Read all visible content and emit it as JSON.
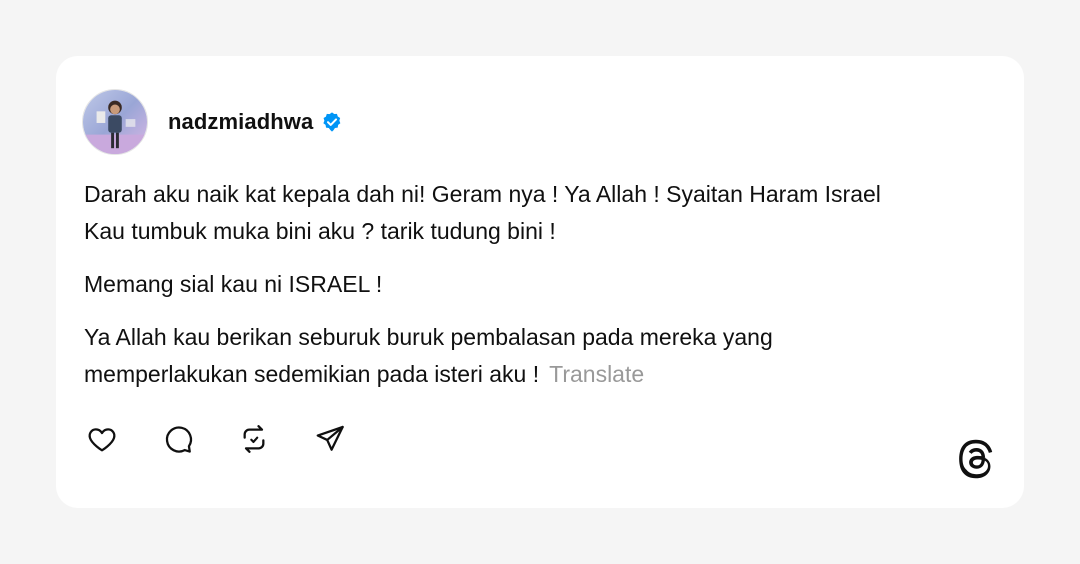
{
  "post": {
    "username": "nadzmiadhwa",
    "verified_badge_icon": "verified-check-icon",
    "avatar_icon": "user-avatar",
    "paragraphs": [
      {
        "line1": "Darah aku naik kat kepala dah ni! Geram nya ! Ya Allah ! Syaitan Haram Israel",
        "line2": "Kau tumbuk muka bini aku ? tarik tudung bini !"
      },
      {
        "line1": "Memang sial kau ni ISRAEL !"
      },
      {
        "line1": "Ya Allah kau berikan seburuk buruk pembalasan pada mereka yang",
        "line2": "memperlakukan sedemikian pada isteri aku !"
      }
    ],
    "translate_label": "Translate"
  },
  "actions": {
    "icons": [
      "heart-icon",
      "comment-icon",
      "repost-icon",
      "share-icon"
    ]
  },
  "brand": {
    "logo_icon": "threads-logo-icon",
    "accent_color": "#0095f6",
    "text_color": "#101010",
    "muted_color": "#999999"
  }
}
